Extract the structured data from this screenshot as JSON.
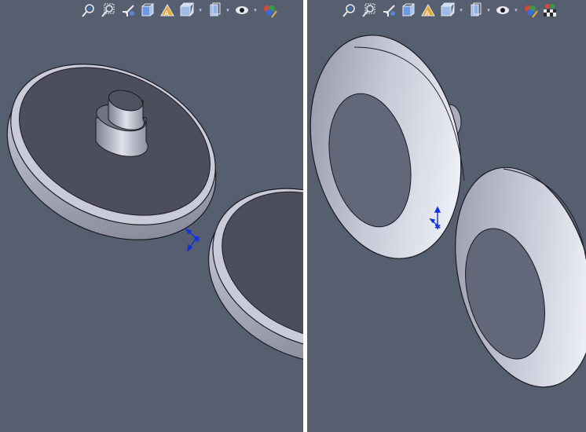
{
  "viewports": [
    {
      "id": "left",
      "toolbar": [
        "zoom-to-fit",
        "zoom-to-area",
        "previous-view",
        "section-view",
        "view-orientation",
        "display-style",
        "hide-show-items",
        "edit-appearance",
        "apply-scene"
      ]
    },
    {
      "id": "right",
      "toolbar": [
        "zoom-to-fit",
        "zoom-to-area",
        "previous-view",
        "section-view",
        "view-orientation",
        "display-style",
        "hide-show-items",
        "edit-appearance",
        "apply-scene"
      ]
    }
  ],
  "colors": {
    "background": "#565f70",
    "part_face_dark": "#4d505c",
    "part_rim": "#a6aabb",
    "part_highlight": "#e4e6ef",
    "triad_axis": "#1030e0",
    "divider": "#ffffff"
  }
}
